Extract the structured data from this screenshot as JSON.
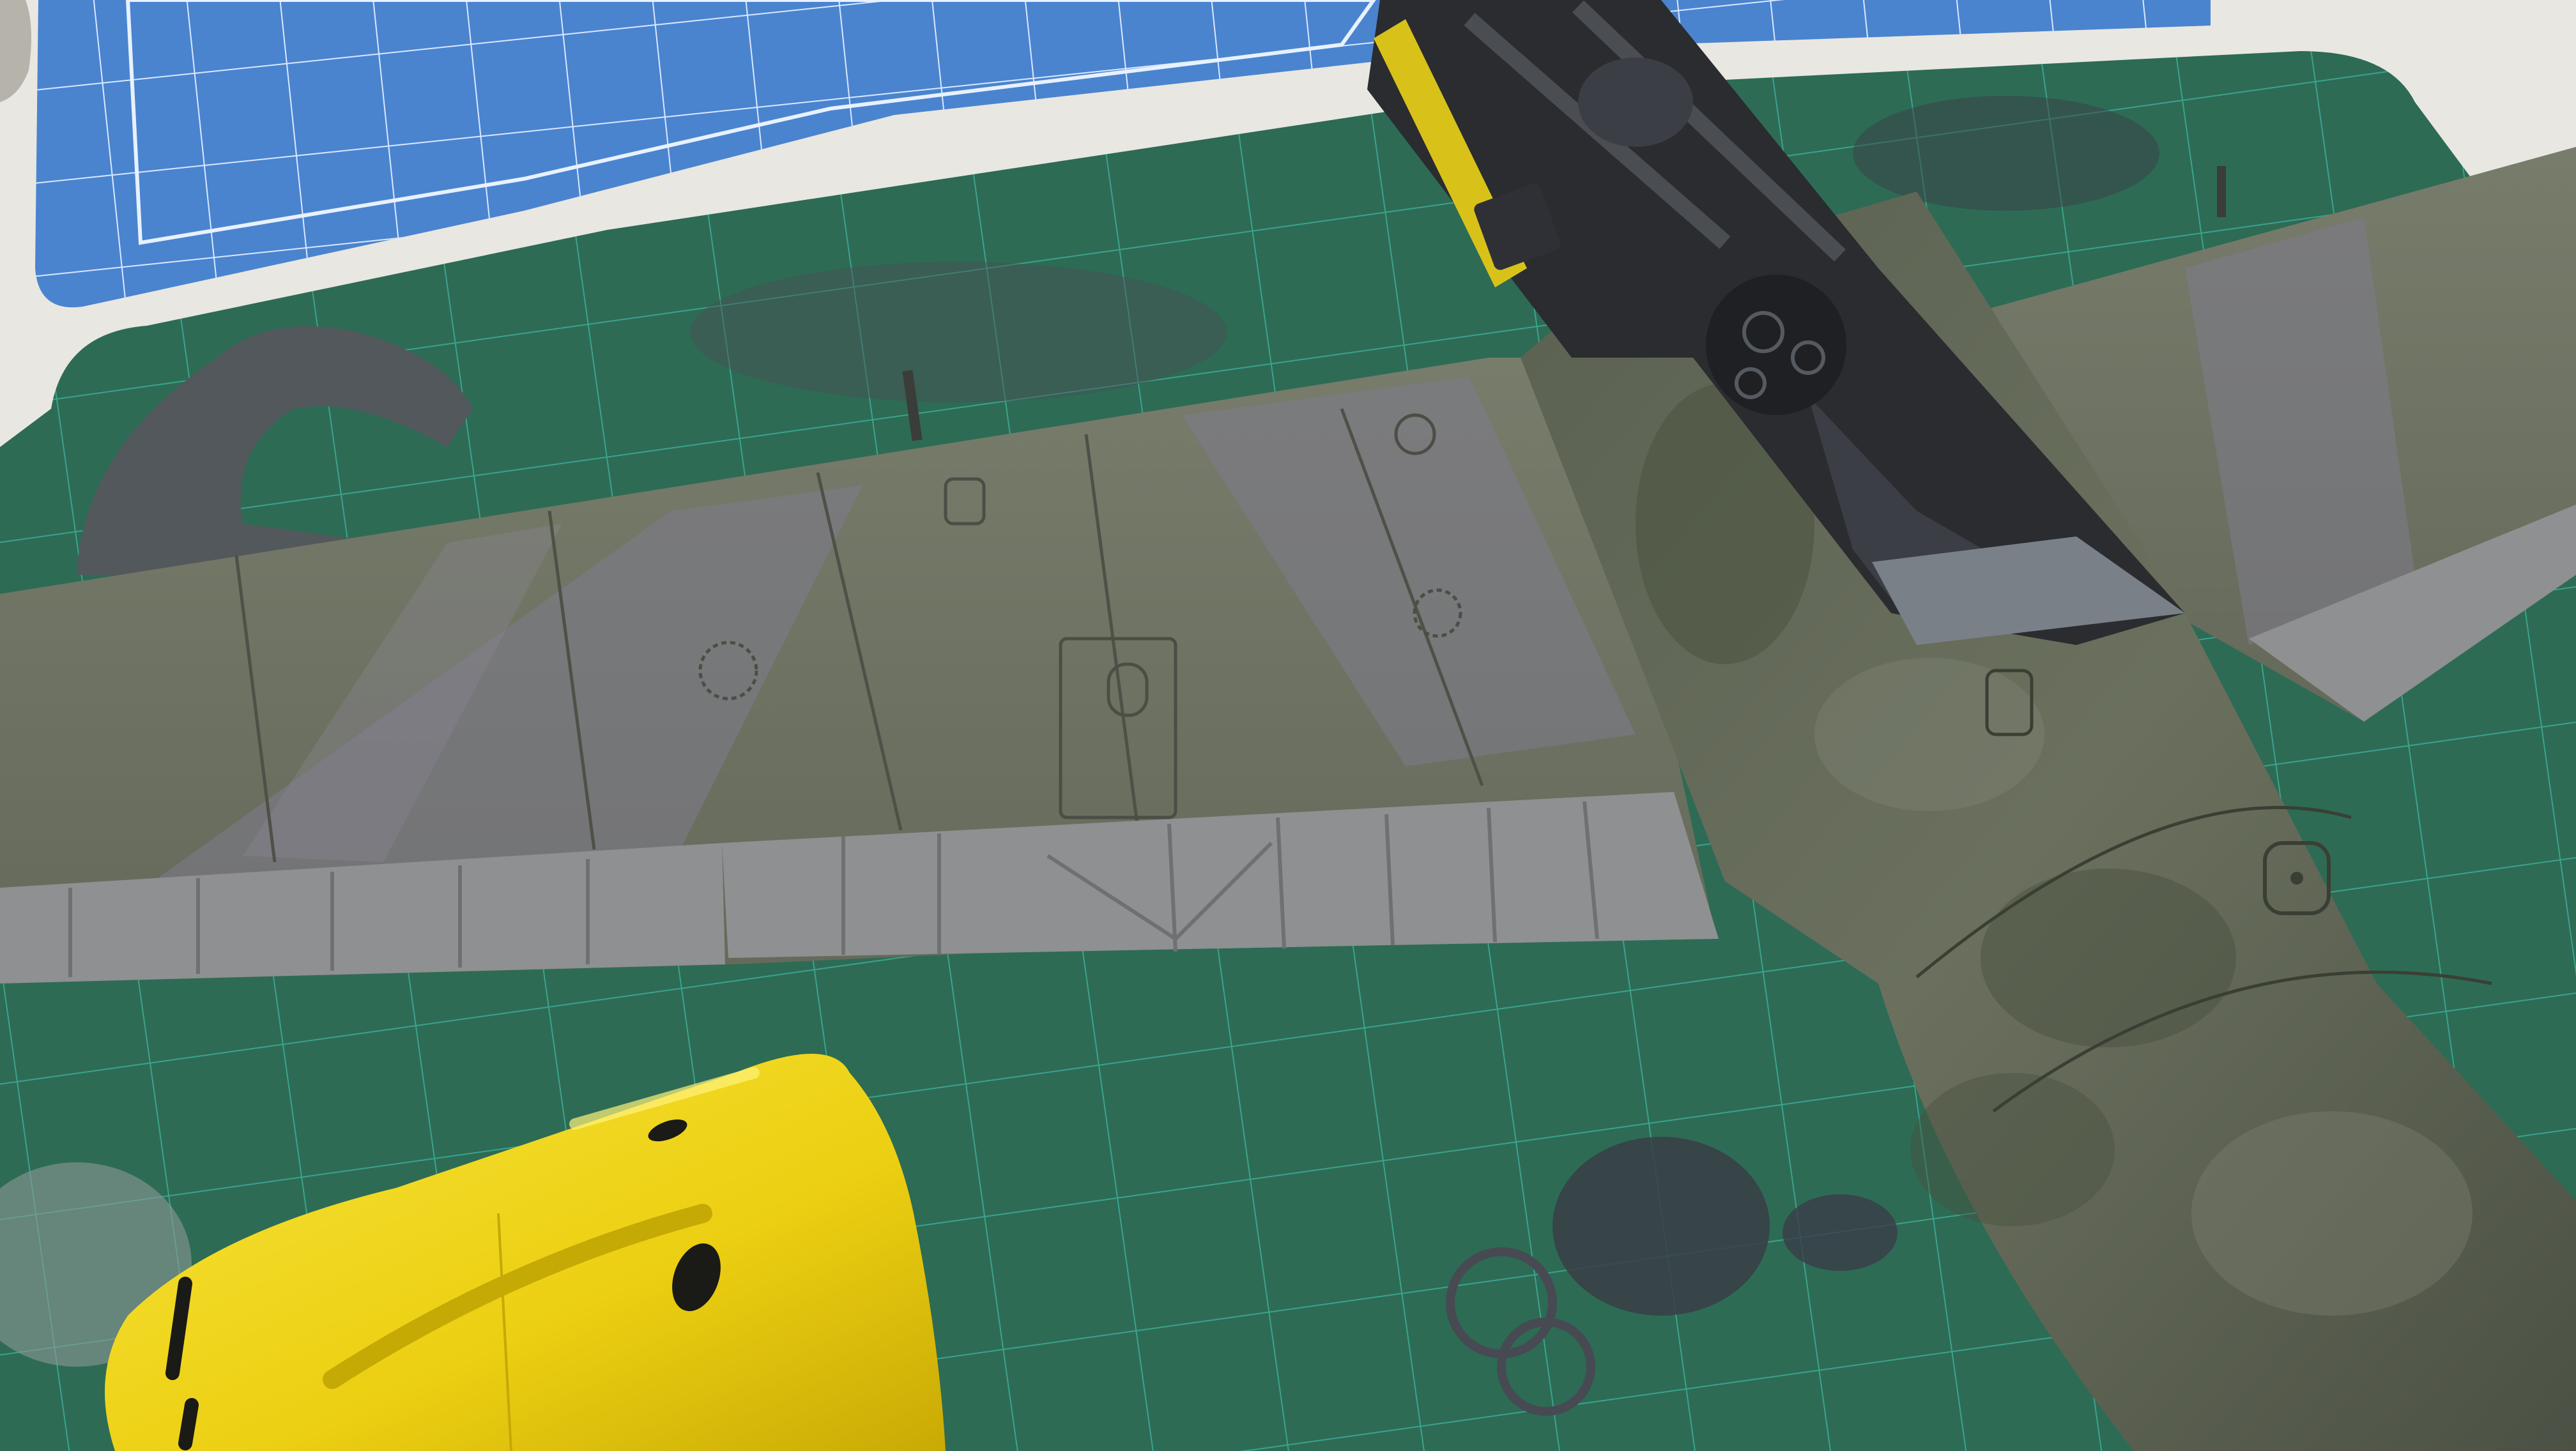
{
  "photo": {
    "palette": {
      "background": "#e9e7e2",
      "cutting_mat_blue": "#4f86cf",
      "work_mat_green": "#2d6b55",
      "wing_grey_green": "#707561",
      "camo_purple_grey": "#7a7a86",
      "control_surface_grey": "#8d8f90",
      "cowling_yellow": "#f0d51a",
      "cockpit_black": "#2a2c30"
    }
  }
}
